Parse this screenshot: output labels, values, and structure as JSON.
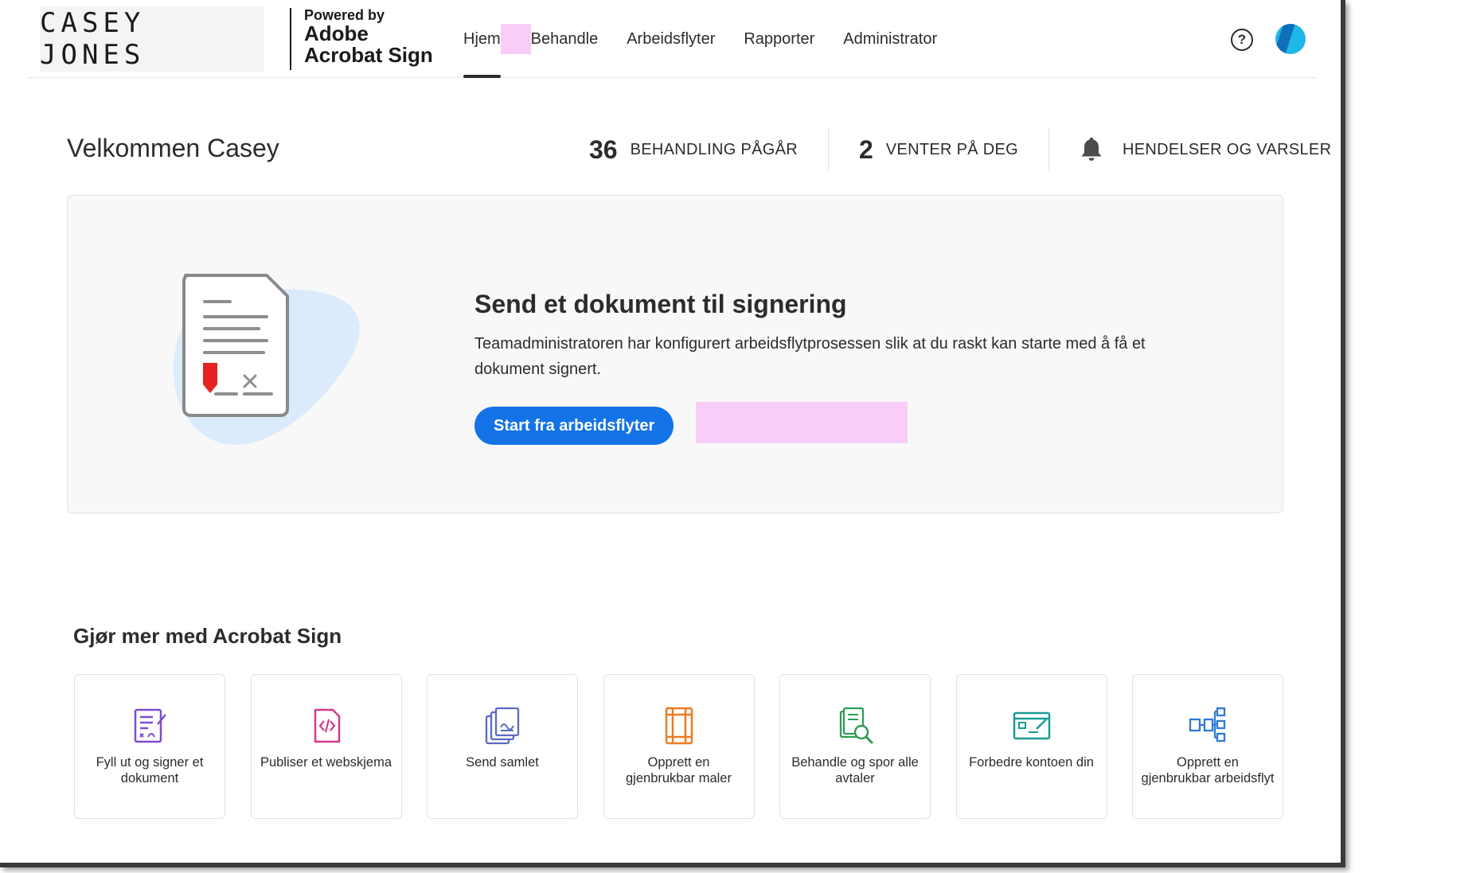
{
  "brand": {
    "logo_text": "CASEY JONES",
    "powered_by": "Powered by",
    "product_line1": "Adobe",
    "product_line2": "Acrobat Sign"
  },
  "nav": {
    "items": [
      {
        "label": "Hjem",
        "active": true
      },
      {
        "label": "Behandle",
        "active": false
      },
      {
        "label": "Arbeidsflyter",
        "active": false
      },
      {
        "label": "Rapporter",
        "active": false
      },
      {
        "label": "Administrator",
        "active": false
      }
    ],
    "help_icon": "help-circle-icon",
    "avatar_icon": "user-avatar"
  },
  "welcome": "Velkommen Casey",
  "stats": [
    {
      "count": "36",
      "label": "BEHANDLING PÅGÅR"
    },
    {
      "count": "2",
      "label": "VENTER PÅ DEG"
    },
    {
      "label": "HENDELSER OG VARSLER",
      "icon": "bell-icon"
    }
  ],
  "hero": {
    "title": "Send et dokument til signering",
    "description": "Teamadministratoren har konfigurert arbeidsflytprosessen slik at du raskt kan starte med å få et dokument signert.",
    "button_label": "Start fra arbeidsflyter"
  },
  "more": {
    "title": "Gjør mer med Acrobat Sign",
    "tiles": [
      {
        "label": "Fyll ut og signer et dokument",
        "icon": "fill-sign-icon",
        "color": "#7e4ccf"
      },
      {
        "label": "Publiser et webskjema",
        "icon": "web-form-icon",
        "color": "#d33a8c"
      },
      {
        "label": "Send samlet",
        "icon": "send-bulk-icon",
        "color": "#5b6ac2"
      },
      {
        "label": "Opprett en gjenbrukbar maler",
        "icon": "template-icon",
        "color": "#e87d22"
      },
      {
        "label": "Behandle og spor alle avtaler",
        "icon": "track-agreements-icon",
        "color": "#2e9e55"
      },
      {
        "label": "Forbedre kontoen din",
        "icon": "brand-account-icon",
        "color": "#1a9a96"
      },
      {
        "label": "Opprett en gjenbrukbar arbeidsflyt",
        "icon": "workflow-icon",
        "color": "#2d7bd6"
      }
    ]
  },
  "colors": {
    "primary_button": "#1473e6",
    "redaction": "#f9cdf7"
  }
}
